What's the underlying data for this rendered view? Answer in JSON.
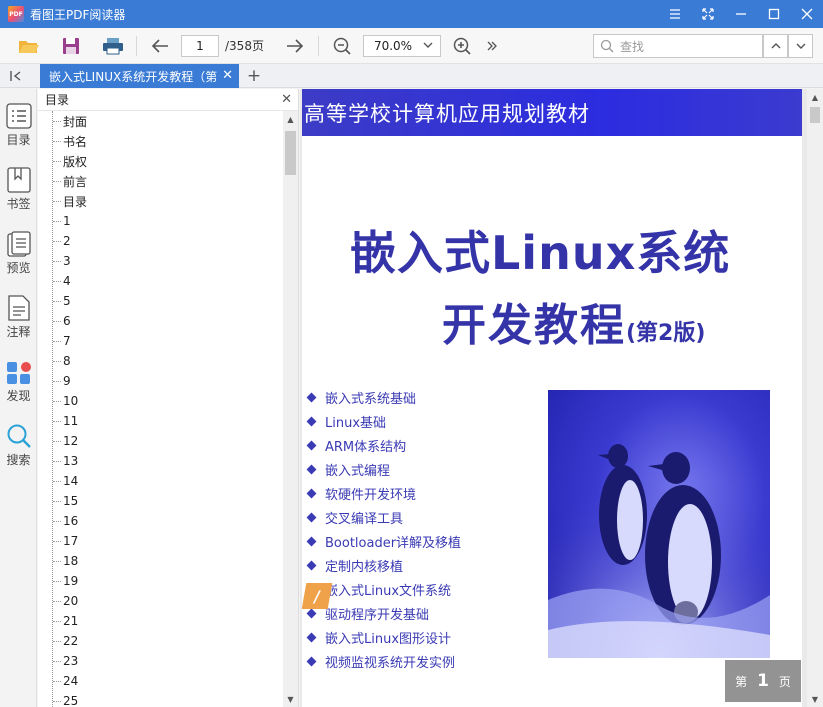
{
  "window": {
    "title": "看图王PDF阅读器",
    "logo_text": "PDF"
  },
  "toolbar": {
    "current_page": "1",
    "total_pages": "/358页",
    "zoom": "70.0%",
    "search_placeholder": "查找"
  },
  "tabs": {
    "doc_tab_label": "嵌入式LINUX系统开发教程（第",
    "new_tab": "+"
  },
  "rail": {
    "items": [
      {
        "label": "目录",
        "icon": "toc-icon"
      },
      {
        "label": "书签",
        "icon": "bookmark-icon"
      },
      {
        "label": "预览",
        "icon": "preview-icon"
      },
      {
        "label": "注释",
        "icon": "annotation-icon"
      },
      {
        "label": "发现",
        "icon": "discover-icon"
      },
      {
        "label": "搜索",
        "icon": "search-icon"
      }
    ]
  },
  "toc": {
    "title": "目录",
    "items": [
      "封面",
      "书名",
      "版权",
      "前言",
      "目录",
      "1",
      "2",
      "3",
      "4",
      "5",
      "6",
      "7",
      "8",
      "9",
      "10",
      "11",
      "12",
      "13",
      "14",
      "15",
      "16",
      "17",
      "18",
      "19",
      "20",
      "21",
      "22",
      "23",
      "24",
      "25"
    ]
  },
  "page": {
    "banner": "高等学校计算机应用规划教材",
    "title_line1": "嵌入式Linux系统",
    "title_line2": "开发教程",
    "edition": "(第2版)",
    "topics": [
      "嵌入式系统基础",
      "Linux基础",
      "ARM体系结构",
      "嵌入式编程",
      "软硬件开发环境",
      "交叉编译工具",
      "Bootloader详解及移植",
      "定制内核移植",
      "嵌入式Linux文件系统",
      "驱动程序开发基础",
      "嵌入式Linux图形设计",
      "视频监视系统开发实例"
    ],
    "badge_prefix": "第",
    "badge_number": "1",
    "badge_suffix": "页"
  },
  "colors": {
    "accent": "#3a7bd5",
    "cover_blue": "#3434a8"
  }
}
